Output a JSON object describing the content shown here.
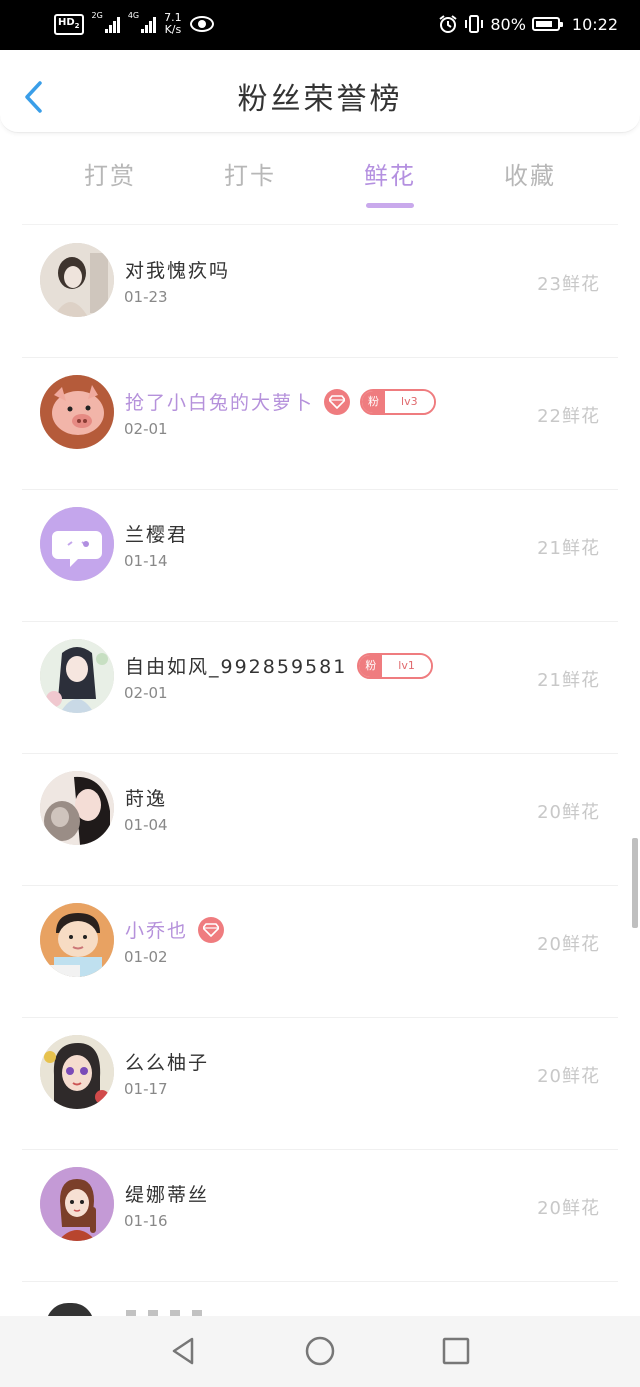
{
  "status_bar": {
    "hd": "HD",
    "hd_sub": "2",
    "net1": "2G",
    "net2": "4G",
    "speed_value": "7.1",
    "speed_unit": "K/s",
    "battery_pct": "80%",
    "battery_level": 0.8,
    "time": "10:22"
  },
  "header": {
    "title": "粉丝荣誉榜"
  },
  "tabs": [
    {
      "label": "打赏",
      "active": false
    },
    {
      "label": "打卡",
      "active": false
    },
    {
      "label": "鲜花",
      "active": true
    },
    {
      "label": "收藏",
      "active": false
    }
  ],
  "fan_badge_prefix": "粉",
  "list": [
    {
      "name": "对我愧疚吗",
      "date": "01-23",
      "count": "23鲜花",
      "vip": false,
      "gem": false,
      "level": null,
      "avatar": "photo-girl-sepia"
    },
    {
      "name": "抢了小白兔的大萝卜",
      "date": "02-01",
      "count": "22鲜花",
      "vip": true,
      "gem": true,
      "level": "lv3",
      "avatar": "photo-piglet"
    },
    {
      "name": "兰樱君",
      "date": "01-14",
      "count": "21鲜花",
      "vip": false,
      "gem": false,
      "level": null,
      "avatar": "default-chat-bubble"
    },
    {
      "name": "自由如风_992859581",
      "date": "02-01",
      "count": "21鲜花",
      "vip": false,
      "gem": false,
      "level": "lv1",
      "avatar": "anime-girl"
    },
    {
      "name": "莳逸",
      "date": "01-04",
      "count": "20鲜花",
      "vip": false,
      "gem": false,
      "level": null,
      "avatar": "photo-girl-cat"
    },
    {
      "name": "小乔也",
      "date": "01-02",
      "count": "20鲜花",
      "vip": true,
      "gem": true,
      "level": null,
      "avatar": "cartoon-boy"
    },
    {
      "name": "么么柚子",
      "date": "01-17",
      "count": "20鲜花",
      "vip": false,
      "gem": false,
      "level": null,
      "avatar": "cartoon-girl-purple"
    },
    {
      "name": "缇娜蒂丝",
      "date": "01-16",
      "count": "20鲜花",
      "vip": false,
      "gem": false,
      "level": null,
      "avatar": "cartoon-girl-braid"
    }
  ],
  "colors": {
    "accent": "#b490e0",
    "gem": "#ef7c7f",
    "count": "#c8c8c8",
    "back": "#3a9ee8"
  },
  "icons": {
    "back": "back-arrow-icon",
    "nav_back": "nav-back-triangle-icon",
    "nav_home": "nav-home-circle-icon",
    "nav_recent": "nav-recent-square-icon"
  }
}
